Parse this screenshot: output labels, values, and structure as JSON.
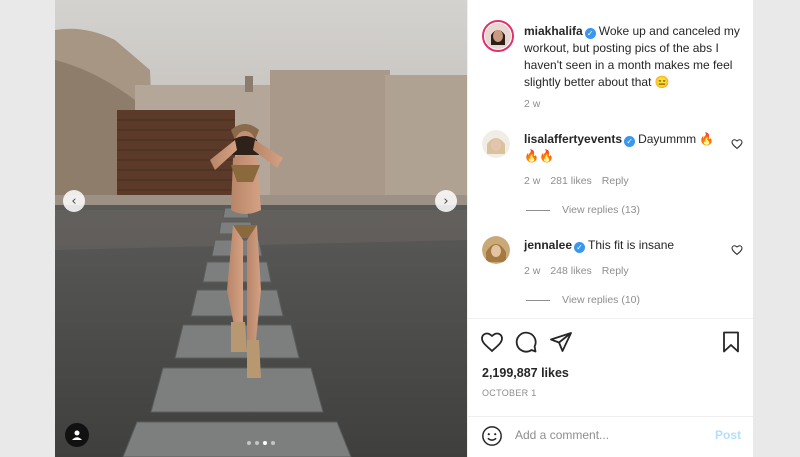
{
  "post": {
    "username": "miakhalifa",
    "caption": "Woke up and canceled my workout, but posting pics of the abs I haven't seen in a month makes me feel slightly better about that 😑",
    "time_ago": "2 w",
    "likes": "2,199,887 likes",
    "date": "OCTOBER 1",
    "carousel_count": 4,
    "carousel_active": 3
  },
  "comments": [
    {
      "username": "lisalaffertyevents",
      "text": "Dayummm 🔥🔥🔥",
      "time_ago": "2 w",
      "likes": "281 likes",
      "reply": "Reply",
      "view_replies": "View replies (13)"
    },
    {
      "username": "jennalee",
      "text": "This fit is insane",
      "time_ago": "2 w",
      "likes": "248 likes",
      "reply": "Reply",
      "view_replies": "View replies (10)"
    }
  ],
  "add_comment": {
    "placeholder": "Add a comment...",
    "post_label": "Post"
  },
  "icons": {
    "like": "heart-icon",
    "comment": "comment-icon",
    "share": "share-icon",
    "save": "bookmark-icon",
    "emoji": "emoji-icon",
    "tag": "user-tag-icon",
    "prev": "chevron-left-icon",
    "next": "chevron-right-icon"
  },
  "colors": {
    "verified": "#3897f0",
    "post_button": "#b2dffc",
    "story_ring": "#e1306c"
  }
}
